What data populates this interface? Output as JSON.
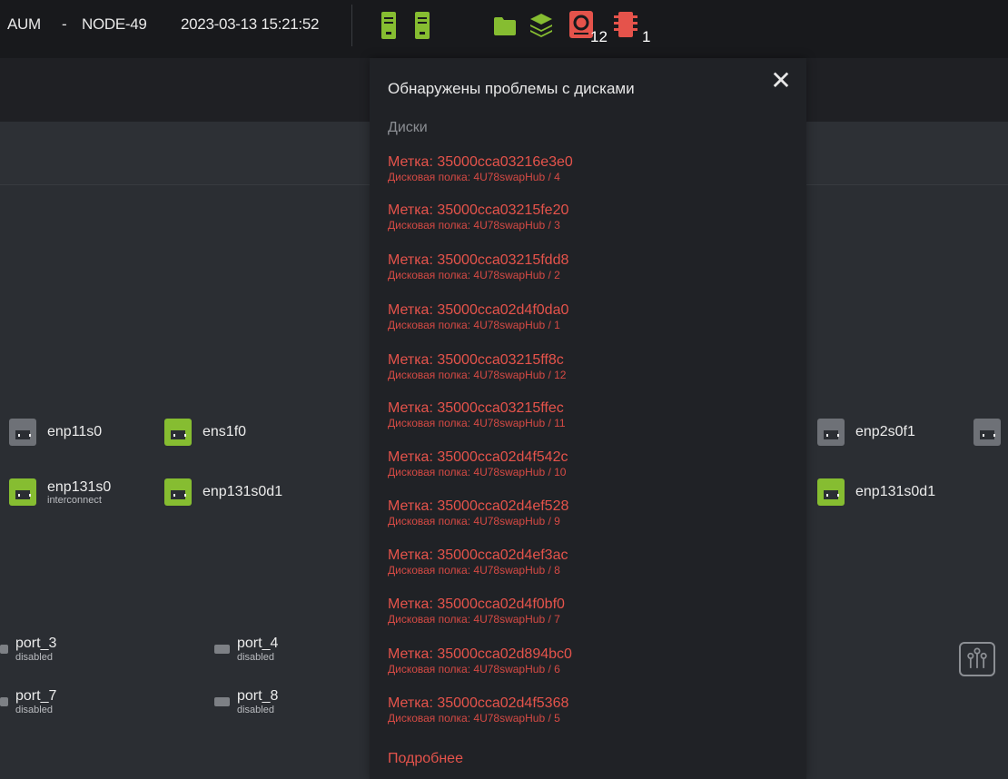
{
  "topbar": {
    "system": "AUM",
    "dash": "-",
    "node": "NODE-49",
    "datetime": "2023-03-13 15:21:52",
    "icons": [
      "server-icon",
      "server-icon",
      "folder-icon",
      "layers-icon",
      "disk-alert-icon",
      "chip-icon"
    ],
    "disk_alert_count": "12",
    "chip_alert_count": "1"
  },
  "colors": {
    "accent_green": "#86bd31",
    "alert_red": "#e5534b",
    "panel_bg": "#202226",
    "topbar_bg": "#18191c"
  },
  "interfaces": [
    {
      "name": "enp11s0",
      "sub": "",
      "state": "grey"
    },
    {
      "name": "ens1f0",
      "sub": "",
      "state": "green"
    },
    {
      "name": "enp131s0",
      "sub": "interconnect",
      "state": "green"
    },
    {
      "name": "enp131s0d1",
      "sub": "",
      "state": "green"
    },
    {
      "name": "enp2s0f1",
      "sub": "",
      "state": "grey"
    },
    {
      "name": "enp131s0d1",
      "sub": "",
      "state": "green"
    }
  ],
  "ports": [
    {
      "name": "port_3",
      "status": "disabled"
    },
    {
      "name": "port_4",
      "status": "disabled"
    },
    {
      "name": "port_7",
      "status": "disabled"
    },
    {
      "name": "port_8",
      "status": "disabled"
    }
  ],
  "panel": {
    "title": "Обнаружены проблемы с дисками",
    "section": "Диски",
    "more": "Подробнее",
    "disks": [
      {
        "label": "Метка: 35000cca03216e3e0",
        "shelf": "Дисковая полка: 4U78swapHub / 4"
      },
      {
        "label": "Метка: 35000cca03215fe20",
        "shelf": "Дисковая полка: 4U78swapHub / 3"
      },
      {
        "label": "Метка: 35000cca03215fdd8",
        "shelf": "Дисковая полка: 4U78swapHub / 2"
      },
      {
        "label": "Метка: 35000cca02d4f0da0",
        "shelf": "Дисковая полка: 4U78swapHub / 1"
      },
      {
        "label": "Метка: 35000cca03215ff8c",
        "shelf": "Дисковая полка: 4U78swapHub / 12"
      },
      {
        "label": "Метка: 35000cca03215ffec",
        "shelf": "Дисковая полка: 4U78swapHub / 11"
      },
      {
        "label": "Метка: 35000cca02d4f542c",
        "shelf": "Дисковая полка: 4U78swapHub / 10"
      },
      {
        "label": "Метка: 35000cca02d4ef528",
        "shelf": "Дисковая полка: 4U78swapHub / 9"
      },
      {
        "label": "Метка: 35000cca02d4ef3ac",
        "shelf": "Дисковая полка: 4U78swapHub / 8"
      },
      {
        "label": "Метка: 35000cca02d4f0bf0",
        "shelf": "Дисковая полка: 4U78swapHub / 7"
      },
      {
        "label": "Метка: 35000cca02d894bc0",
        "shelf": "Дисковая полка: 4U78swapHub / 6"
      },
      {
        "label": "Метка: 35000cca02d4f5368",
        "shelf": "Дисковая полка: 4U78swapHub / 5"
      }
    ]
  }
}
